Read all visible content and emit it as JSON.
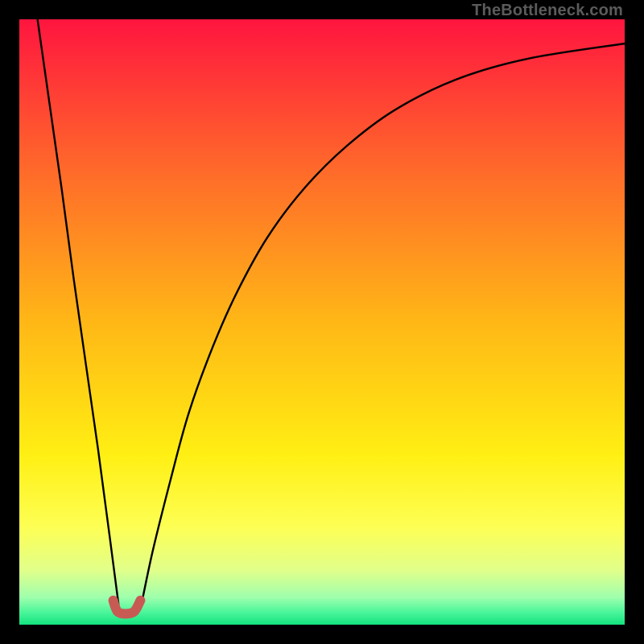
{
  "watermark": "TheBottleneck.com",
  "chart_data": {
    "type": "line",
    "title": "",
    "xlabel": "",
    "ylabel": "",
    "xlim": [
      0,
      100
    ],
    "ylim": [
      0,
      100
    ],
    "grid": false,
    "legend": false,
    "background_gradient_stops": [
      {
        "pos": 0.0,
        "color": "#ff153f"
      },
      {
        "pos": 0.25,
        "color": "#ff6a2a"
      },
      {
        "pos": 0.5,
        "color": "#ffb716"
      },
      {
        "pos": 0.72,
        "color": "#ffef13"
      },
      {
        "pos": 0.84,
        "color": "#fdff55"
      },
      {
        "pos": 0.91,
        "color": "#e1ff8a"
      },
      {
        "pos": 0.955,
        "color": "#9fffad"
      },
      {
        "pos": 0.98,
        "color": "#49f59a"
      },
      {
        "pos": 1.0,
        "color": "#13e27e"
      }
    ],
    "series": [
      {
        "name": "left-branch",
        "stroke": "#000000",
        "stroke_width": 2.4,
        "x": [
          3,
          5,
          7,
          9,
          11,
          13,
          15,
          16.5
        ],
        "y": [
          100,
          86,
          72,
          57,
          43,
          29,
          14,
          2.5
        ]
      },
      {
        "name": "right-branch",
        "stroke": "#000000",
        "stroke_width": 2.4,
        "x": [
          20,
          22,
          25,
          28,
          32,
          36,
          41,
          47,
          54,
          62,
          72,
          84,
          100
        ],
        "y": [
          2.5,
          12,
          24,
          35,
          46,
          55,
          64,
          72,
          79,
          85,
          90,
          93.5,
          96
        ]
      },
      {
        "name": "valley-marker",
        "stroke": "#c85a54",
        "stroke_width": 12,
        "linecap": "round",
        "x": [
          15.5,
          16.2,
          17.5,
          19.0,
          20.0
        ],
        "y": [
          4.0,
          2.2,
          1.8,
          2.2,
          4.0
        ]
      }
    ],
    "minimum": {
      "x": 18,
      "y": 2
    }
  }
}
